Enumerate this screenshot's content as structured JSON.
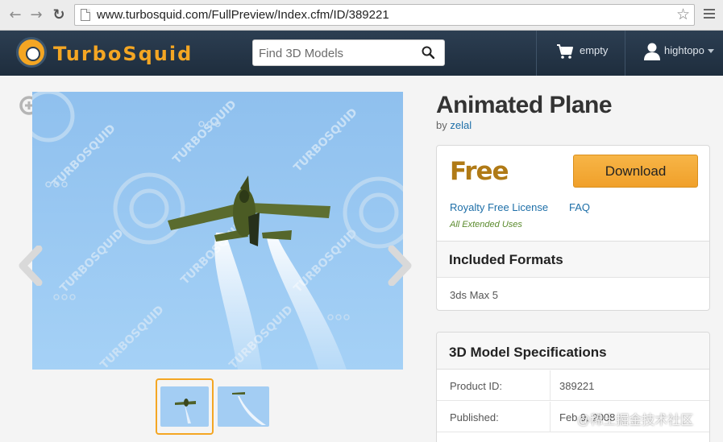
{
  "browser": {
    "url": "www.turbosquid.com/FullPreview/Index.cfm/ID/389221",
    "back_icon": "arrow-left-icon",
    "forward_icon": "arrow-right-icon",
    "reload_icon": "reload-icon",
    "bookmark_icon": "star-icon",
    "menu_icon": "hamburger-icon"
  },
  "header": {
    "logo_text": "TurboSquid",
    "search_placeholder": "Find 3D Models",
    "cart_label": "empty",
    "user_label": "hightopo"
  },
  "gallery": {
    "watermark_text": "TURBOSQUID",
    "thumbnails": [
      "thumb-1",
      "thumb-2"
    ],
    "active_thumbnail": 1
  },
  "product": {
    "title": "Animated Plane",
    "by_prefix": "by",
    "author": "zelal",
    "price": "Free",
    "download_label": "Download",
    "license_link": "Royalty Free License",
    "faq_link": "FAQ",
    "extended_uses": "All Extended Uses",
    "formats_heading": "Included Formats",
    "formats_value": "3ds Max 5",
    "specs_heading": "3D Model Specifications",
    "specs": [
      {
        "label": "Product ID:",
        "value": "389221"
      },
      {
        "label": "Published:",
        "value": "Feb 9, 2008"
      }
    ]
  },
  "overlay_watermark": "@稀土掘金技术社区",
  "colors": {
    "header_bg": "#24364a",
    "accent": "#f4a623",
    "link": "#1e6fa8",
    "price": "#b07a16"
  }
}
